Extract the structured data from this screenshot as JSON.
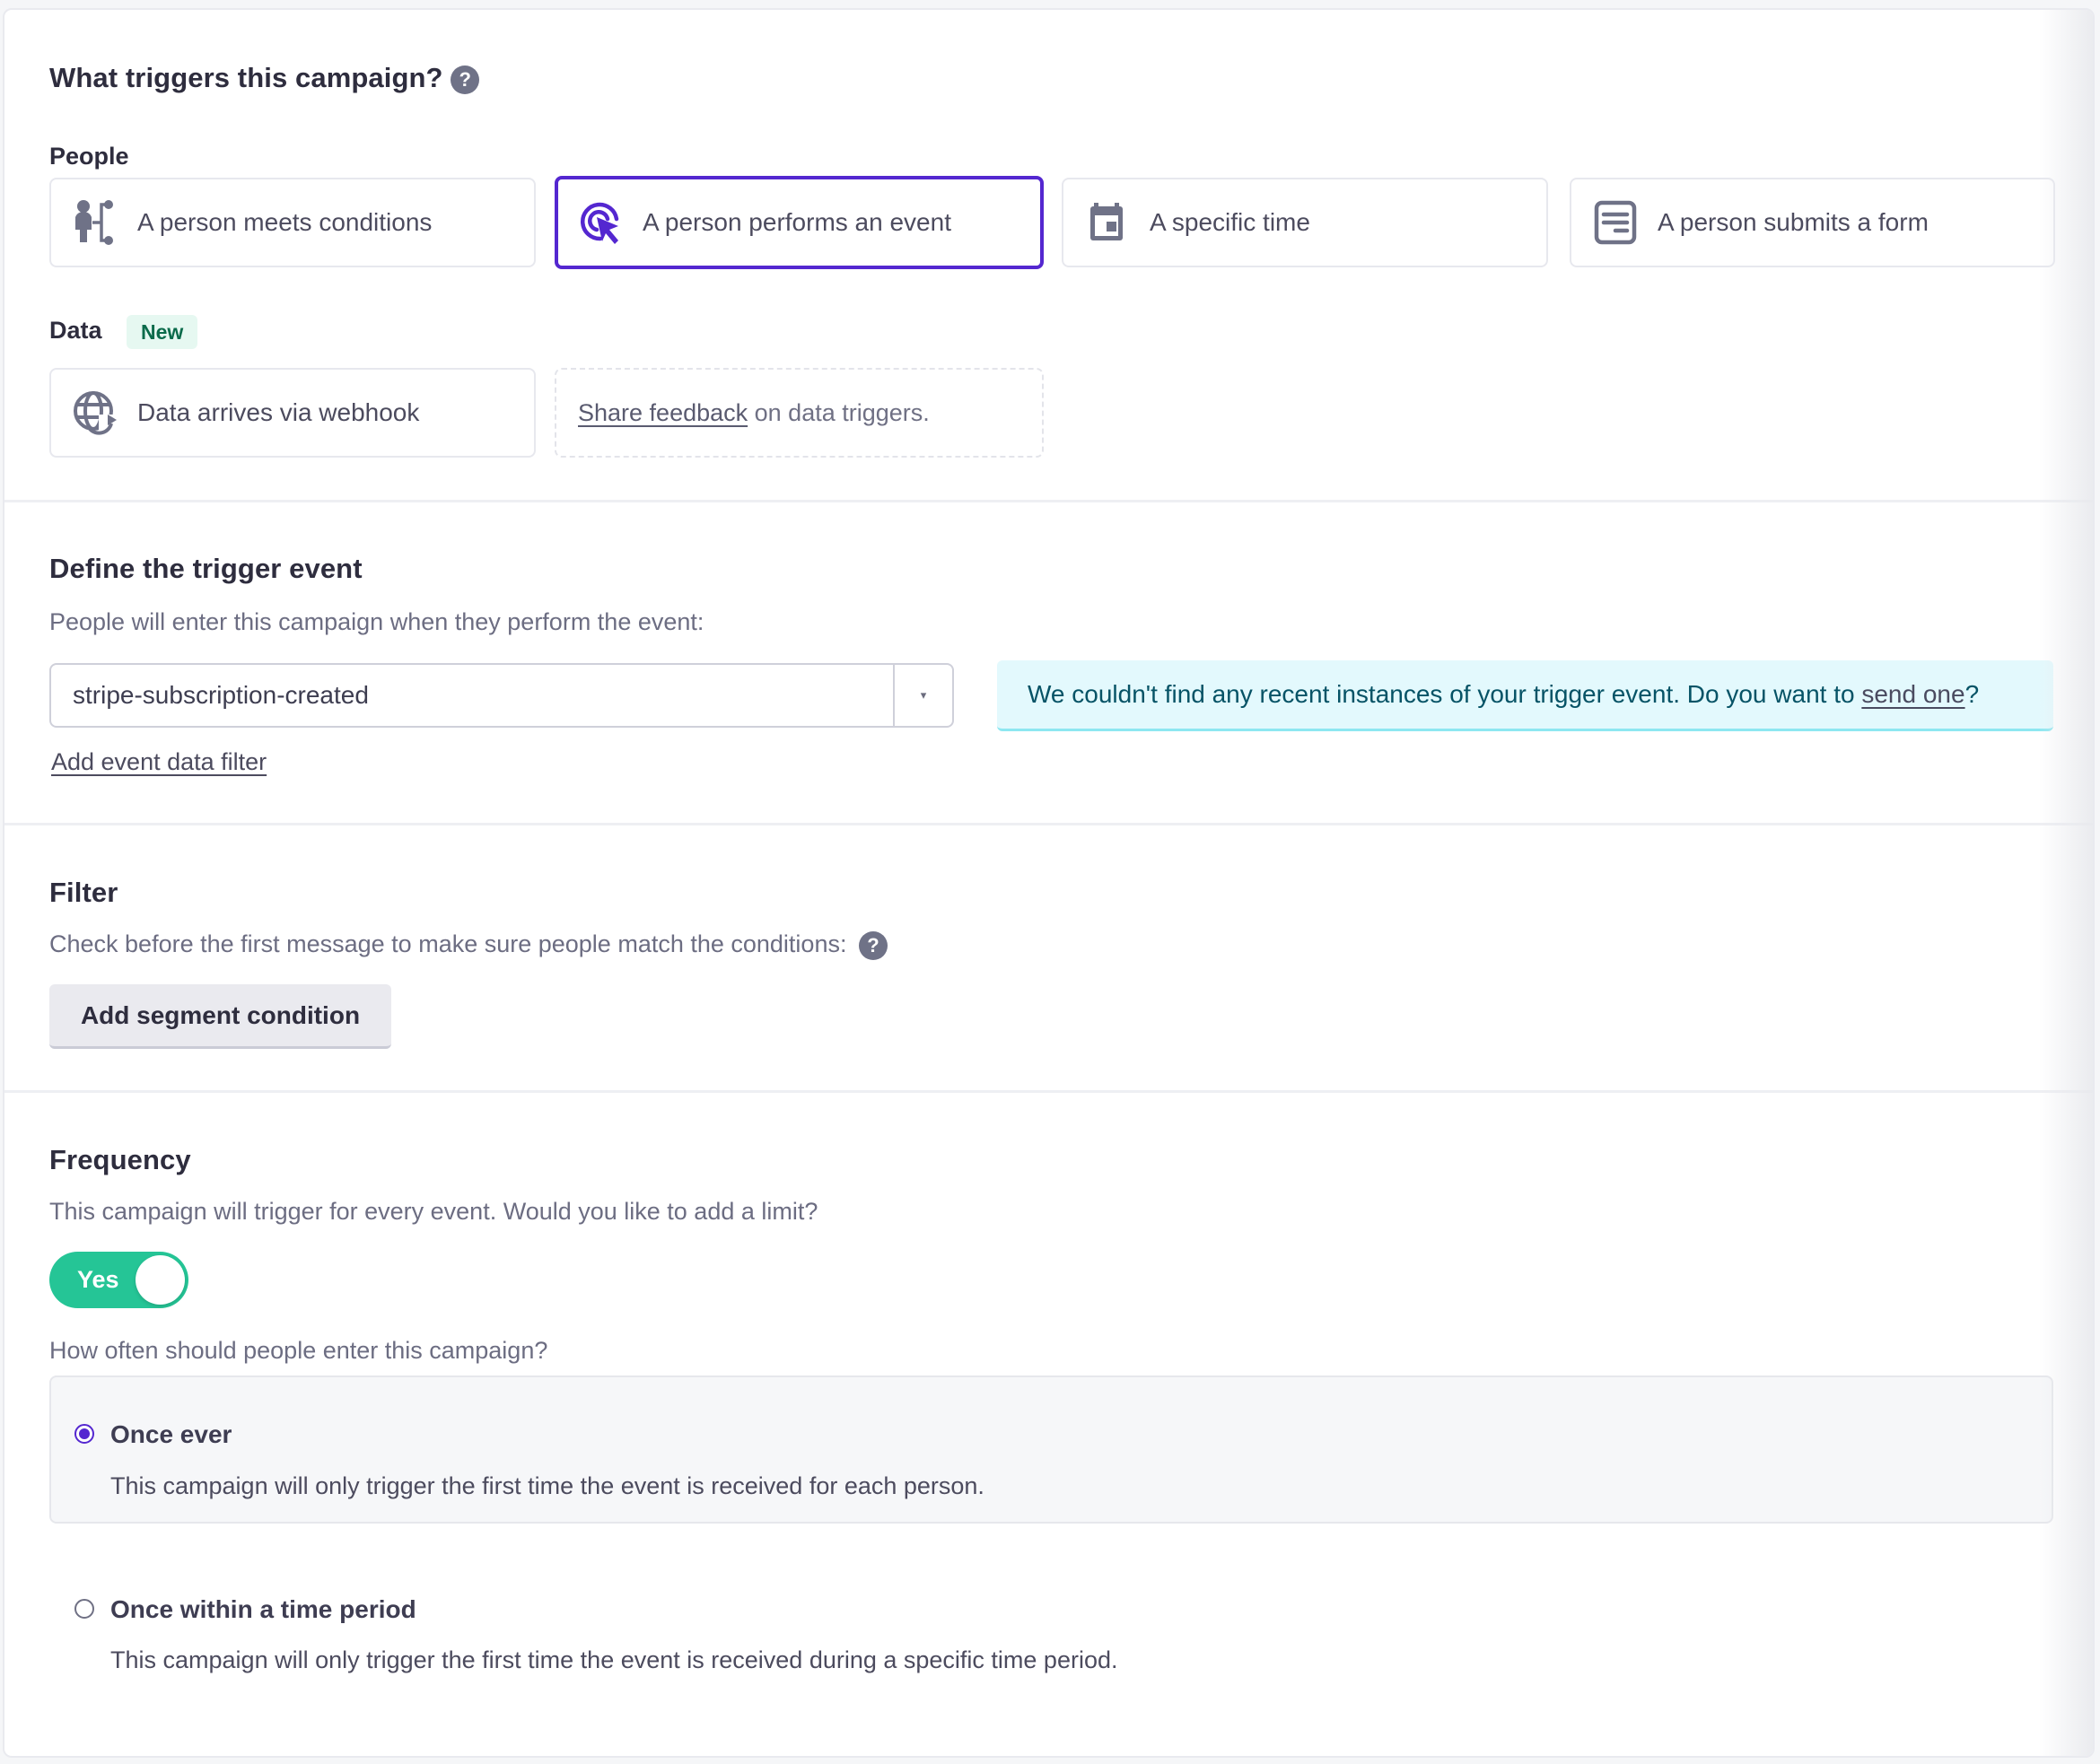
{
  "triggers": {
    "title": "What triggers this campaign?",
    "help_icon": "question-circle-icon",
    "people_label": "People",
    "people_options": [
      {
        "label": "A person meets conditions",
        "icon": "person-branch-icon",
        "selected": false
      },
      {
        "label": "A person performs an event",
        "icon": "cursor-click-icon",
        "selected": true
      },
      {
        "label": "A specific time",
        "icon": "calendar-icon",
        "selected": false
      },
      {
        "label": "A person submits a form",
        "icon": "form-icon",
        "selected": false
      }
    ],
    "data_label": "Data",
    "data_badge": "New",
    "data_options": [
      {
        "label": "Data arrives via webhook",
        "icon": "globe-sync-icon",
        "selected": false
      }
    ],
    "feedback": {
      "link": "Share feedback",
      "text": " on data triggers."
    }
  },
  "trigger_event": {
    "title": "Define the trigger event",
    "subtitle": "People will enter this campaign when they perform the event:",
    "select_value": "stripe-subscription-created",
    "caret": "▾",
    "add_filter_link": "Add event data filter",
    "alert": {
      "text": "We couldn't find any recent instances of your trigger event. Do you want to ",
      "link": "send one",
      "suffix": "?"
    }
  },
  "filter": {
    "title": "Filter",
    "subtitle": "Check before the first message to make sure people match the conditions:",
    "button": "Add segment condition"
  },
  "frequency": {
    "title": "Frequency",
    "subtitle": "This campaign will trigger for every event. Would you like to add a limit?",
    "toggle_label": "Yes",
    "toggle_on": true,
    "question": "How often should people enter this campaign?",
    "options": [
      {
        "title": "Once ever",
        "description": "This campaign will only trigger the first time the event is received for each person.",
        "selected": true
      },
      {
        "title": "Once within a time period",
        "description": "This campaign will only trigger the first time the event is received during a specific time period.",
        "selected": false
      }
    ]
  },
  "colors": {
    "accent": "#5427d0",
    "toggle_on": "#25c596",
    "icon_gray": "#6f7287",
    "alert_bg": "#e3f9fd",
    "badge_bg": "#e6f8f1"
  }
}
